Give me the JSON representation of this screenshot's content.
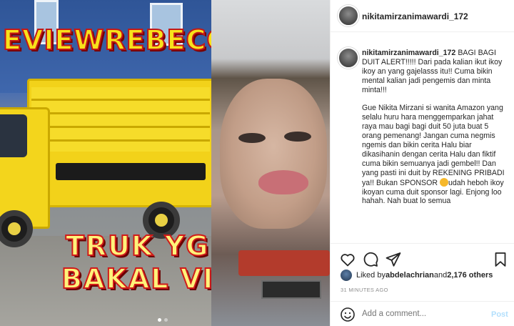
{
  "header": {
    "username": "nikitamirzanimawardi_172"
  },
  "media": {
    "overlay_top": "EVIEWREBECCA",
    "overlay_line1": "TRUK YG",
    "overlay_line2": "BAKAL VIRAL",
    "carousel": {
      "total": 2,
      "active": 1
    }
  },
  "caption": {
    "username": "nikitamirzanimawardi_172",
    "paragraphs": [
      "BAGI BAGI DUIT ALERT!!!!! Dari pada kalian ikut ikoy ikoy an yang gajelasss itu!! Cuma bikin mental kalian jadi pengemis dan minta minta!!!",
      "Gue Nikita Mirzani si wanita Amazon yang selalu huru hara menggemparkan jahat raya mau bagi bagi duit 50 juta buat 5 orang pemenang! Jangan cuma negmis ngemis dan bikin cerita Halu biar dikasihanin dengan cerita Halu dan fiktif cuma bikin semuanya jadi gembel!! Dan yang pasti ini duit by REKENING PRIBADI ya!! Bukan SPONSOR",
      "udah heboh ikoy ikoyan cuma duit sponsor lagi. Enjong loo hahah. Nah buat lo semua"
    ]
  },
  "icons": {
    "like": "heart-icon",
    "comment": "comment-icon",
    "share": "paper-plane-icon",
    "save": "bookmark-icon",
    "emoji": "smile-emoji-icon"
  },
  "likes": {
    "prefix": "Liked by ",
    "user": "abdelachrian",
    "middle": " and ",
    "others": "2,176 others"
  },
  "timestamp": "31 MINUTES AGO",
  "comment": {
    "placeholder": "Add a comment...",
    "post_label": "Post"
  },
  "colors": {
    "accent": "#0095f6",
    "post_disabled": "#b2dffc",
    "text": "#262626",
    "muted": "#8e8e8e"
  }
}
